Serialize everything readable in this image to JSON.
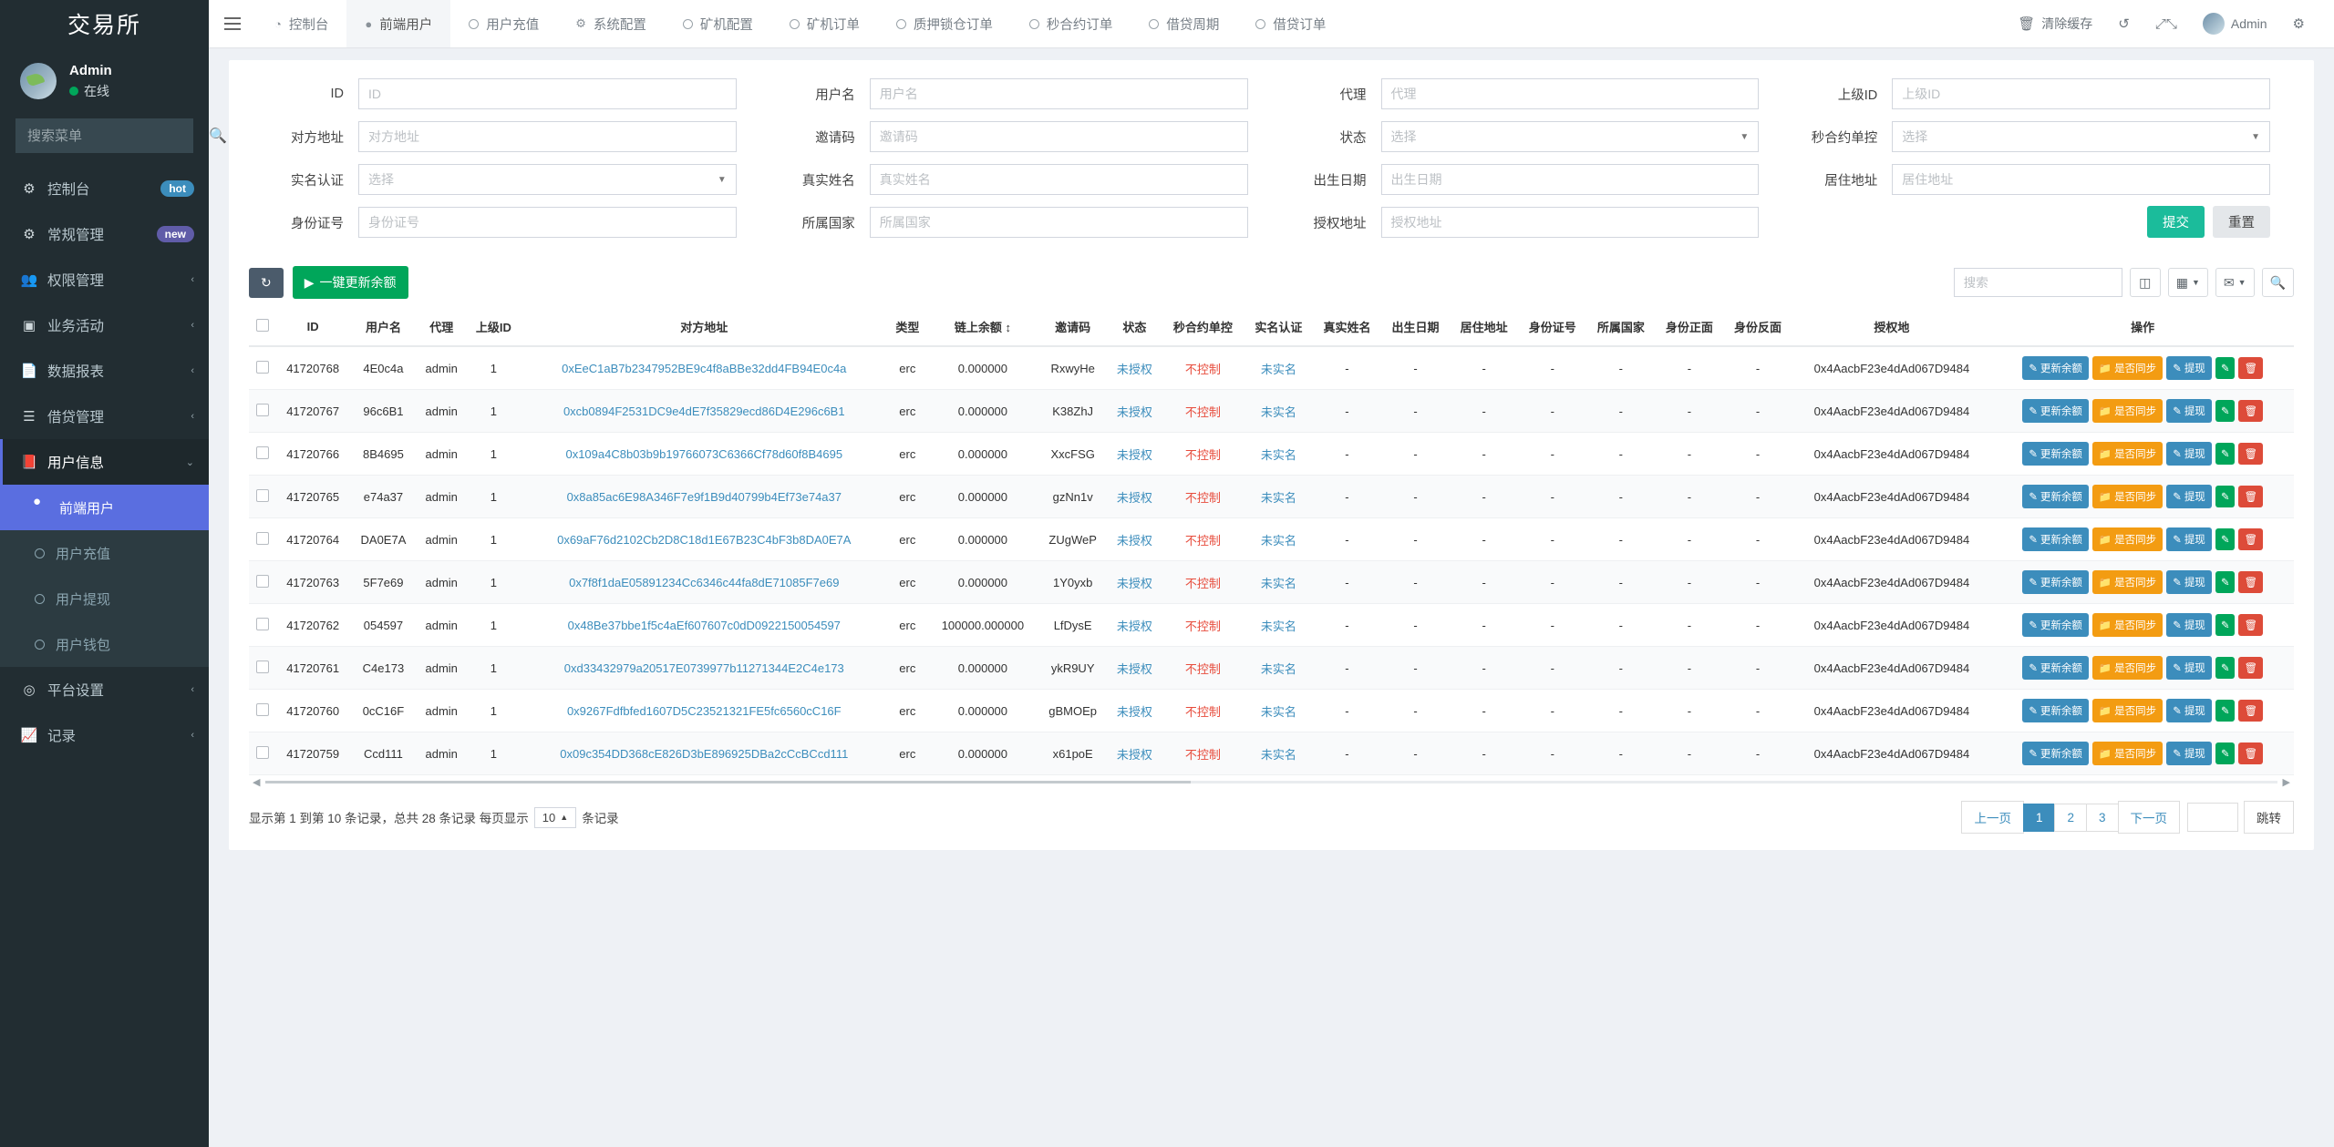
{
  "sidebar": {
    "brand": "交易所",
    "user": {
      "name": "Admin",
      "status": "在线"
    },
    "search_placeholder": "搜索菜单",
    "items": [
      {
        "label": "控制台",
        "icon": "dashboard-icon",
        "badge": "hot",
        "badge_type": "hot"
      },
      {
        "label": "常规管理",
        "icon": "gears-icon",
        "badge": "new",
        "badge_type": "new"
      },
      {
        "label": "权限管理",
        "icon": "users-icon",
        "badge": "",
        "caret": "‹"
      },
      {
        "label": "业务活动",
        "icon": "window-icon",
        "badge": "",
        "caret": "‹"
      },
      {
        "label": "数据报表",
        "icon": "file-icon",
        "badge": "",
        "caret": "‹"
      },
      {
        "label": "借贷管理",
        "icon": "list-icon",
        "badge": "",
        "caret": "‹"
      },
      {
        "label": "用户信息",
        "icon": "contact-icon",
        "badge": "",
        "caret": "⌄"
      },
      {
        "label": "平台设置",
        "icon": "target-icon",
        "badge": "",
        "caret": "‹"
      },
      {
        "label": "记录",
        "icon": "chart-icon",
        "badge": "",
        "caret": "‹"
      }
    ],
    "submenu": [
      {
        "label": "前端用户",
        "active": true
      },
      {
        "label": "用户充值",
        "active": false
      },
      {
        "label": "用户提现",
        "active": false
      },
      {
        "label": "用户钱包",
        "active": false
      }
    ]
  },
  "topnav": {
    "tabs": [
      {
        "label": "控制台",
        "icon": "dashboard-icon",
        "current": false
      },
      {
        "label": "前端用户",
        "icon": "user-circle-icon",
        "current": true
      },
      {
        "label": "用户充值",
        "icon": "ring-icon",
        "current": false
      },
      {
        "label": "系统配置",
        "icon": "gear-icon",
        "current": false
      },
      {
        "label": "矿机配置",
        "icon": "ring-icon",
        "current": false
      },
      {
        "label": "矿机订单",
        "icon": "ring-icon",
        "current": false
      },
      {
        "label": "质押锁仓订单",
        "icon": "ring-icon",
        "current": false
      },
      {
        "label": "秒合约订单",
        "icon": "ring-icon",
        "current": false
      },
      {
        "label": "借贷周期",
        "icon": "ring-icon",
        "current": false
      },
      {
        "label": "借贷订单",
        "icon": "ring-icon",
        "current": false
      }
    ],
    "right": {
      "clear_cache": "清除缓存",
      "refresh_icon": "refresh-icon",
      "fullscreen_icon": "fullscreen-icon",
      "user": "Admin",
      "settings_icon": "gear-icon"
    }
  },
  "search_form": {
    "rows": [
      [
        {
          "label": "ID",
          "placeholder": "ID",
          "type": "input"
        },
        {
          "label": "用户名",
          "placeholder": "用户名",
          "type": "input"
        },
        {
          "label": "代理",
          "placeholder": "代理",
          "type": "input"
        },
        {
          "label": "上级ID",
          "placeholder": "上级ID",
          "type": "input"
        }
      ],
      [
        {
          "label": "对方地址",
          "placeholder": "对方地址",
          "type": "input"
        },
        {
          "label": "邀请码",
          "placeholder": "邀请码",
          "type": "input"
        },
        {
          "label": "状态",
          "placeholder": "选择",
          "type": "select"
        },
        {
          "label": "秒合约单控",
          "placeholder": "选择",
          "type": "select"
        }
      ],
      [
        {
          "label": "实名认证",
          "placeholder": "选择",
          "type": "select"
        },
        {
          "label": "真实姓名",
          "placeholder": "真实姓名",
          "type": "input"
        },
        {
          "label": "出生日期",
          "placeholder": "出生日期",
          "type": "input"
        },
        {
          "label": "居住地址",
          "placeholder": "居住地址",
          "type": "input"
        }
      ],
      [
        {
          "label": "身份证号",
          "placeholder": "身份证号",
          "type": "input"
        },
        {
          "label": "所属国家",
          "placeholder": "所属国家",
          "type": "input"
        },
        {
          "label": "授权地址",
          "placeholder": "授权地址",
          "type": "input"
        },
        {
          "label": "",
          "placeholder": "",
          "type": "buttons"
        }
      ]
    ],
    "submit_label": "提交",
    "reset_label": "重置"
  },
  "toolbar": {
    "refresh_icon": "refresh-icon",
    "batch_update_label": "一键更新余额",
    "search_placeholder": "搜索",
    "columns_icon": "columns-icon",
    "grid_icon": "grid-icon",
    "export_icon": "export-icon",
    "search_icon": "search-icon"
  },
  "table": {
    "columns": [
      "ID",
      "用户名",
      "代理",
      "上级ID",
      "对方地址",
      "类型",
      "链上余额",
      "邀请码",
      "状态",
      "秒合约单控",
      "实名认证",
      "真实姓名",
      "出生日期",
      "居住地址",
      "身份证号",
      "所属国家",
      "身份正面",
      "身份反面",
      "授权地",
      "操作"
    ],
    "action_labels": {
      "update_balance": "更新余额",
      "sync": "是否同步",
      "withdraw": "提现"
    },
    "rows": [
      {
        "id": "41720768",
        "username": "4E0c4a",
        "agent": "admin",
        "parent_id": "1",
        "address": "0xEeC1aB7b2347952BE9c4f8aBBe32dd4FB94E0c4a",
        "type": "erc",
        "balance": "0.000000",
        "invite": "RxwyHe",
        "status": "未授权",
        "control": "不控制",
        "realname_auth": "未实名",
        "realname": "-",
        "birth": "-",
        "residence": "-",
        "idcard": "-",
        "country": "-",
        "id_front": "-",
        "id_back": "-",
        "auth_addr": "0x4AacbF23e4dAd067D9484"
      },
      {
        "id": "41720767",
        "username": "96c6B1",
        "agent": "admin",
        "parent_id": "1",
        "address": "0xcb0894F2531DC9e4dE7f35829ecd86D4E296c6B1",
        "type": "erc",
        "balance": "0.000000",
        "invite": "K38ZhJ",
        "status": "未授权",
        "control": "不控制",
        "realname_auth": "未实名",
        "realname": "-",
        "birth": "-",
        "residence": "-",
        "idcard": "-",
        "country": "-",
        "id_front": "-",
        "id_back": "-",
        "auth_addr": "0x4AacbF23e4dAd067D9484"
      },
      {
        "id": "41720766",
        "username": "8B4695",
        "agent": "admin",
        "parent_id": "1",
        "address": "0x109a4C8b03b9b19766073C6366Cf78d60f8B4695",
        "type": "erc",
        "balance": "0.000000",
        "invite": "XxcFSG",
        "status": "未授权",
        "control": "不控制",
        "realname_auth": "未实名",
        "realname": "-",
        "birth": "-",
        "residence": "-",
        "idcard": "-",
        "country": "-",
        "id_front": "-",
        "id_back": "-",
        "auth_addr": "0x4AacbF23e4dAd067D9484"
      },
      {
        "id": "41720765",
        "username": "e74a37",
        "agent": "admin",
        "parent_id": "1",
        "address": "0x8a85ac6E98A346F7e9f1B9d40799b4Ef73e74a37",
        "type": "erc",
        "balance": "0.000000",
        "invite": "gzNn1v",
        "status": "未授权",
        "control": "不控制",
        "realname_auth": "未实名",
        "realname": "-",
        "birth": "-",
        "residence": "-",
        "idcard": "-",
        "country": "-",
        "id_front": "-",
        "id_back": "-",
        "auth_addr": "0x4AacbF23e4dAd067D9484"
      },
      {
        "id": "41720764",
        "username": "DA0E7A",
        "agent": "admin",
        "parent_id": "1",
        "address": "0x69aF76d2102Cb2D8C18d1E67B23C4bF3b8DA0E7A",
        "type": "erc",
        "balance": "0.000000",
        "invite": "ZUgWeP",
        "status": "未授权",
        "control": "不控制",
        "realname_auth": "未实名",
        "realname": "-",
        "birth": "-",
        "residence": "-",
        "idcard": "-",
        "country": "-",
        "id_front": "-",
        "id_back": "-",
        "auth_addr": "0x4AacbF23e4dAd067D9484"
      },
      {
        "id": "41720763",
        "username": "5F7e69",
        "agent": "admin",
        "parent_id": "1",
        "address": "0x7f8f1daE05891234Cc6346c44fa8dE71085F7e69",
        "type": "erc",
        "balance": "0.000000",
        "invite": "1Y0yxb",
        "status": "未授权",
        "control": "不控制",
        "realname_auth": "未实名",
        "realname": "-",
        "birth": "-",
        "residence": "-",
        "idcard": "-",
        "country": "-",
        "id_front": "-",
        "id_back": "-",
        "auth_addr": "0x4AacbF23e4dAd067D9484"
      },
      {
        "id": "41720762",
        "username": "054597",
        "agent": "admin",
        "parent_id": "1",
        "address": "0x48Be37bbe1f5c4aEf607607c0dD0922150054597",
        "type": "erc",
        "balance": "100000.000000",
        "invite": "LfDysE",
        "status": "未授权",
        "control": "不控制",
        "realname_auth": "未实名",
        "realname": "-",
        "birth": "-",
        "residence": "-",
        "idcard": "-",
        "country": "-",
        "id_front": "-",
        "id_back": "-",
        "auth_addr": "0x4AacbF23e4dAd067D9484"
      },
      {
        "id": "41720761",
        "username": "C4e173",
        "agent": "admin",
        "parent_id": "1",
        "address": "0xd33432979a20517E0739977b11271344E2C4e173",
        "type": "erc",
        "balance": "0.000000",
        "invite": "ykR9UY",
        "status": "未授权",
        "control": "不控制",
        "realname_auth": "未实名",
        "realname": "-",
        "birth": "-",
        "residence": "-",
        "idcard": "-",
        "country": "-",
        "id_front": "-",
        "id_back": "-",
        "auth_addr": "0x4AacbF23e4dAd067D9484"
      },
      {
        "id": "41720760",
        "username": "0cC16F",
        "agent": "admin",
        "parent_id": "1",
        "address": "0x9267Fdfbfed1607D5C23521321FE5fc6560cC16F",
        "type": "erc",
        "balance": "0.000000",
        "invite": "gBMOEp",
        "status": "未授权",
        "control": "不控制",
        "realname_auth": "未实名",
        "realname": "-",
        "birth": "-",
        "residence": "-",
        "idcard": "-",
        "country": "-",
        "id_front": "-",
        "id_back": "-",
        "auth_addr": "0x4AacbF23e4dAd067D9484"
      },
      {
        "id": "41720759",
        "username": "Ccd111",
        "agent": "admin",
        "parent_id": "1",
        "address": "0x09c354DD368cE826D3bE896925DBa2cCcBCcd111",
        "type": "erc",
        "balance": "0.000000",
        "invite": "x61poE",
        "status": "未授权",
        "control": "不控制",
        "realname_auth": "未实名",
        "realname": "-",
        "birth": "-",
        "residence": "-",
        "idcard": "-",
        "country": "-",
        "id_front": "-",
        "id_back": "-",
        "auth_addr": "0x4AacbF23e4dAd067D9484"
      }
    ]
  },
  "footer": {
    "info_prefix": "显示第 1 到第 10 条记录，总共 28 条记录 每页显示",
    "per_page": "10",
    "info_suffix": "条记录",
    "prev": "上一页",
    "pages": [
      "1",
      "2",
      "3"
    ],
    "current_page": "1",
    "next": "下一页",
    "jump": "跳转"
  },
  "colors": {
    "sidebar_bg": "#222d32",
    "accent_blue": "#3c8dbc",
    "accent_green": "#00a65a",
    "accent_teal": "#1bbc9b",
    "accent_orange": "#f39c12",
    "accent_red": "#dd4b39",
    "active_purple": "#5a6ee0"
  }
}
